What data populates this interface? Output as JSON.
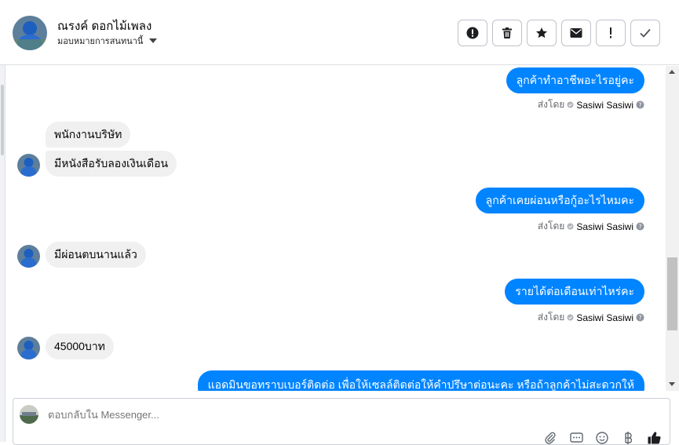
{
  "header": {
    "contact_name": "ณรงค์ ดอกไม้เพลง",
    "assign_label": "มอบหมายการสนทนานี้",
    "actions": [
      {
        "name": "spam-button",
        "icon": "exclamation-circle-icon"
      },
      {
        "name": "delete-button",
        "icon": "trash-icon"
      },
      {
        "name": "star-button",
        "icon": "star-icon"
      },
      {
        "name": "mark-unread-button",
        "icon": "envelope-icon"
      },
      {
        "name": "follow-up-button",
        "icon": "exclamation-icon"
      },
      {
        "name": "mark-done-button",
        "icon": "check-icon"
      }
    ]
  },
  "thread": {
    "messages": [
      {
        "dir": "out",
        "text": "ลูกค้าทำอาชีพอะไรอยู่คะ"
      },
      {
        "dir": "meta",
        "prefix": "ส่งโดย",
        "sender": "Sasiwi Sasiwi"
      },
      {
        "dir": "in",
        "text": "พนักงานบริษัท"
      },
      {
        "dir": "in",
        "text": "มีหนังสือรับลองเงินเดือน"
      },
      {
        "dir": "out",
        "text": "ลูกค้าเคยผ่อนหรือกู้อะไรไหมคะ"
      },
      {
        "dir": "meta",
        "prefix": "ส่งโดย",
        "sender": "Sasiwi Sasiwi"
      },
      {
        "dir": "in",
        "text": "มีผ่อนตบนานแล้ว"
      },
      {
        "dir": "out",
        "text": "รายได้ต่อเดือนเท่าไหร่คะ"
      },
      {
        "dir": "meta",
        "prefix": "ส่งโดย",
        "sender": "Sasiwi Sasiwi"
      },
      {
        "dir": "in",
        "text": "45000บาท"
      },
      {
        "dir": "out",
        "text": "แอดมินขอทราบเบอร์ติดต่อ เพื่อให้เซลล์ติดต่อให้คำปรึษาต่อนะคะ หรือถ้าลูกค้าไม่สะดวกให้"
      }
    ]
  },
  "composer": {
    "placeholder": "ตอบกลับใน Messenger...",
    "tools": [
      "paperclip-icon",
      "saved-replies-icon",
      "emoji-icon",
      "baht-icon",
      "thumbs-up-icon"
    ]
  },
  "colors": {
    "outgoing_bubble": "#0084ff",
    "incoming_bubble": "#f0f0f0",
    "border": "#dddfe2"
  }
}
